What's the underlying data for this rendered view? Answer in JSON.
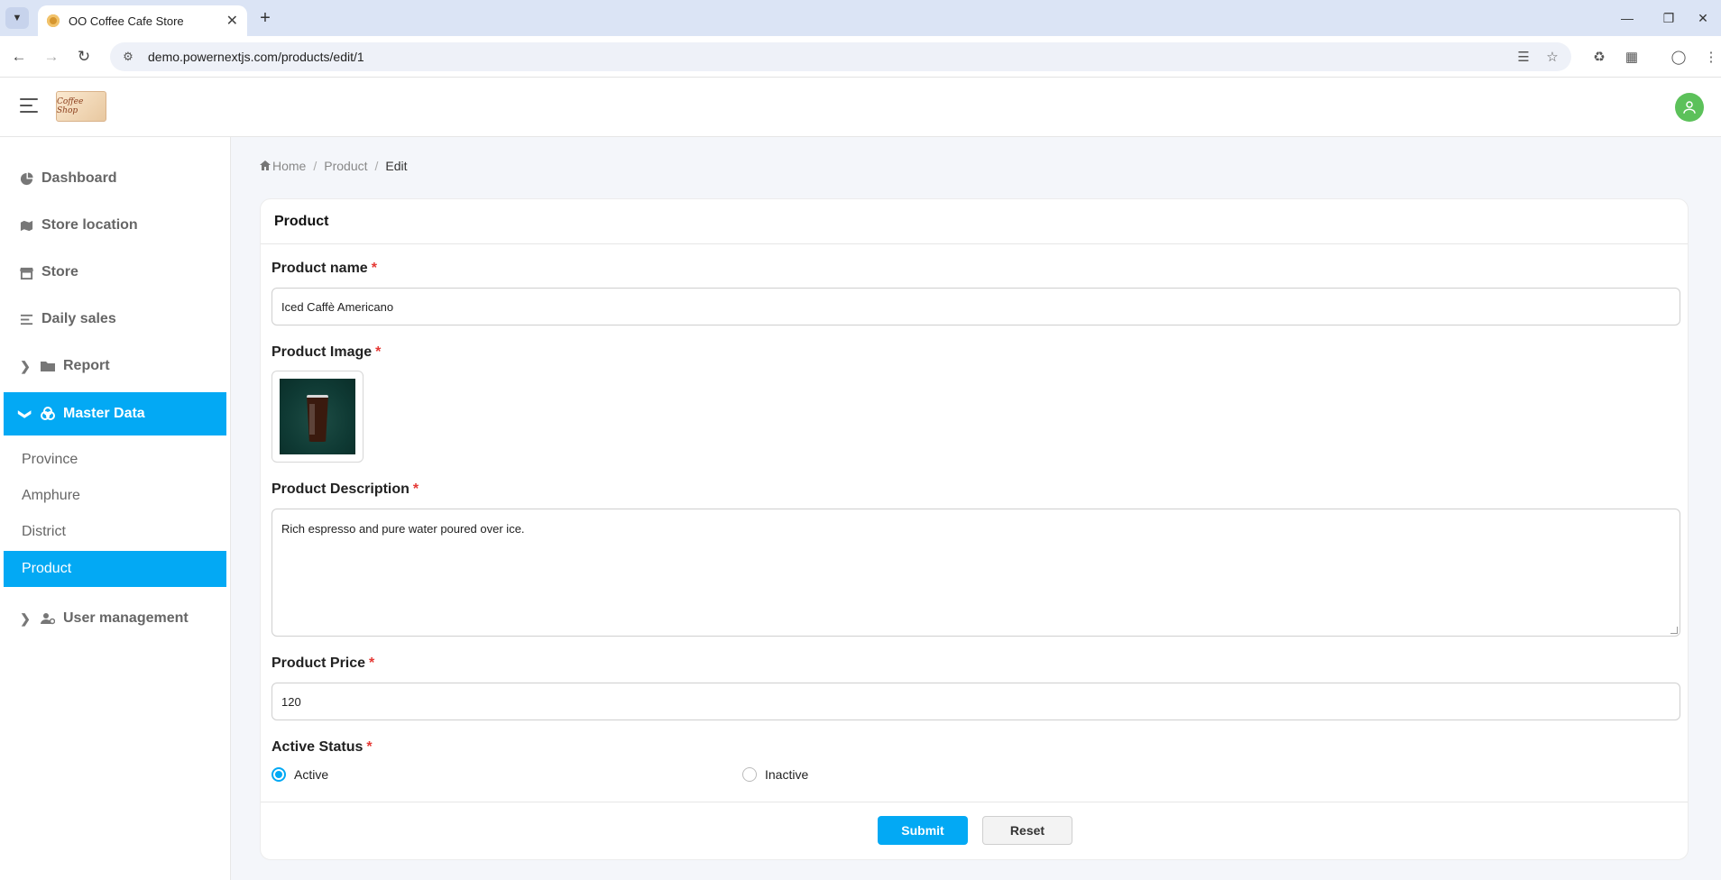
{
  "browser": {
    "tab_title": "OO Coffee Cafe Store",
    "url": "demo.powernextjs.com/products/edit/1"
  },
  "app": {
    "logo_text": "Coffee Shop"
  },
  "sidebar": {
    "items": [
      {
        "label": "Dashboard",
        "icon": "pie-chart-icon"
      },
      {
        "label": "Store location",
        "icon": "map-icon"
      },
      {
        "label": "Store",
        "icon": "store-icon"
      },
      {
        "label": "Daily sales",
        "icon": "list-icon"
      },
      {
        "label": "Report",
        "icon": "folder-icon"
      },
      {
        "label": "Master Data",
        "icon": "cubes-icon"
      },
      {
        "label": "User management",
        "icon": "users-cog-icon"
      }
    ],
    "sub_items": [
      "Province",
      "Amphure",
      "District",
      "Product"
    ]
  },
  "breadcrumb": {
    "home": "Home",
    "section": "Product",
    "current": "Edit"
  },
  "form": {
    "title": "Product",
    "name_label": "Product name",
    "name_value": "Iced Caffè Americano",
    "image_label": "Product Image",
    "description_label": "Product Description",
    "description_value": "Rich espresso and pure water poured over ice.",
    "price_label": "Product Price",
    "price_value": "120",
    "status_label": "Active Status",
    "status_options": [
      "Active",
      "Inactive"
    ],
    "status_selected": "Active",
    "required_mark": "*",
    "submit_label": "Submit",
    "reset_label": "Reset"
  },
  "colors": {
    "accent": "#03a9f4",
    "required": "#e53935",
    "avatar": "#5cc15a"
  }
}
